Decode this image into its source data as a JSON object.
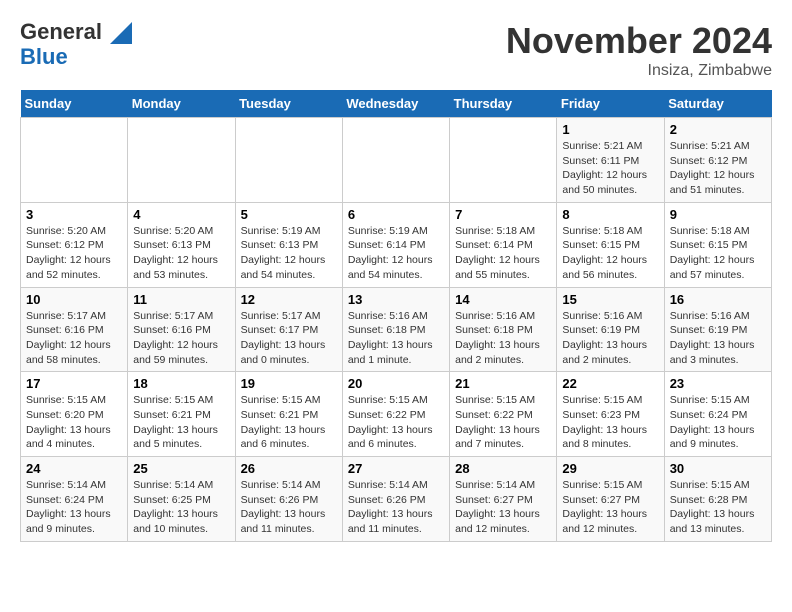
{
  "header": {
    "logo_line1": "General",
    "logo_line2": "Blue",
    "month": "November 2024",
    "location": "Insiza, Zimbabwe"
  },
  "weekdays": [
    "Sunday",
    "Monday",
    "Tuesday",
    "Wednesday",
    "Thursday",
    "Friday",
    "Saturday"
  ],
  "weeks": [
    [
      {
        "day": "",
        "info": ""
      },
      {
        "day": "",
        "info": ""
      },
      {
        "day": "",
        "info": ""
      },
      {
        "day": "",
        "info": ""
      },
      {
        "day": "",
        "info": ""
      },
      {
        "day": "1",
        "info": "Sunrise: 5:21 AM\nSunset: 6:11 PM\nDaylight: 12 hours and 50 minutes."
      },
      {
        "day": "2",
        "info": "Sunrise: 5:21 AM\nSunset: 6:12 PM\nDaylight: 12 hours and 51 minutes."
      }
    ],
    [
      {
        "day": "3",
        "info": "Sunrise: 5:20 AM\nSunset: 6:12 PM\nDaylight: 12 hours and 52 minutes."
      },
      {
        "day": "4",
        "info": "Sunrise: 5:20 AM\nSunset: 6:13 PM\nDaylight: 12 hours and 53 minutes."
      },
      {
        "day": "5",
        "info": "Sunrise: 5:19 AM\nSunset: 6:13 PM\nDaylight: 12 hours and 54 minutes."
      },
      {
        "day": "6",
        "info": "Sunrise: 5:19 AM\nSunset: 6:14 PM\nDaylight: 12 hours and 54 minutes."
      },
      {
        "day": "7",
        "info": "Sunrise: 5:18 AM\nSunset: 6:14 PM\nDaylight: 12 hours and 55 minutes."
      },
      {
        "day": "8",
        "info": "Sunrise: 5:18 AM\nSunset: 6:15 PM\nDaylight: 12 hours and 56 minutes."
      },
      {
        "day": "9",
        "info": "Sunrise: 5:18 AM\nSunset: 6:15 PM\nDaylight: 12 hours and 57 minutes."
      }
    ],
    [
      {
        "day": "10",
        "info": "Sunrise: 5:17 AM\nSunset: 6:16 PM\nDaylight: 12 hours and 58 minutes."
      },
      {
        "day": "11",
        "info": "Sunrise: 5:17 AM\nSunset: 6:16 PM\nDaylight: 12 hours and 59 minutes."
      },
      {
        "day": "12",
        "info": "Sunrise: 5:17 AM\nSunset: 6:17 PM\nDaylight: 13 hours and 0 minutes."
      },
      {
        "day": "13",
        "info": "Sunrise: 5:16 AM\nSunset: 6:18 PM\nDaylight: 13 hours and 1 minute."
      },
      {
        "day": "14",
        "info": "Sunrise: 5:16 AM\nSunset: 6:18 PM\nDaylight: 13 hours and 2 minutes."
      },
      {
        "day": "15",
        "info": "Sunrise: 5:16 AM\nSunset: 6:19 PM\nDaylight: 13 hours and 2 minutes."
      },
      {
        "day": "16",
        "info": "Sunrise: 5:16 AM\nSunset: 6:19 PM\nDaylight: 13 hours and 3 minutes."
      }
    ],
    [
      {
        "day": "17",
        "info": "Sunrise: 5:15 AM\nSunset: 6:20 PM\nDaylight: 13 hours and 4 minutes."
      },
      {
        "day": "18",
        "info": "Sunrise: 5:15 AM\nSunset: 6:21 PM\nDaylight: 13 hours and 5 minutes."
      },
      {
        "day": "19",
        "info": "Sunrise: 5:15 AM\nSunset: 6:21 PM\nDaylight: 13 hours and 6 minutes."
      },
      {
        "day": "20",
        "info": "Sunrise: 5:15 AM\nSunset: 6:22 PM\nDaylight: 13 hours and 6 minutes."
      },
      {
        "day": "21",
        "info": "Sunrise: 5:15 AM\nSunset: 6:22 PM\nDaylight: 13 hours and 7 minutes."
      },
      {
        "day": "22",
        "info": "Sunrise: 5:15 AM\nSunset: 6:23 PM\nDaylight: 13 hours and 8 minutes."
      },
      {
        "day": "23",
        "info": "Sunrise: 5:15 AM\nSunset: 6:24 PM\nDaylight: 13 hours and 9 minutes."
      }
    ],
    [
      {
        "day": "24",
        "info": "Sunrise: 5:14 AM\nSunset: 6:24 PM\nDaylight: 13 hours and 9 minutes."
      },
      {
        "day": "25",
        "info": "Sunrise: 5:14 AM\nSunset: 6:25 PM\nDaylight: 13 hours and 10 minutes."
      },
      {
        "day": "26",
        "info": "Sunrise: 5:14 AM\nSunset: 6:26 PM\nDaylight: 13 hours and 11 minutes."
      },
      {
        "day": "27",
        "info": "Sunrise: 5:14 AM\nSunset: 6:26 PM\nDaylight: 13 hours and 11 minutes."
      },
      {
        "day": "28",
        "info": "Sunrise: 5:14 AM\nSunset: 6:27 PM\nDaylight: 13 hours and 12 minutes."
      },
      {
        "day": "29",
        "info": "Sunrise: 5:15 AM\nSunset: 6:27 PM\nDaylight: 13 hours and 12 minutes."
      },
      {
        "day": "30",
        "info": "Sunrise: 5:15 AM\nSunset: 6:28 PM\nDaylight: 13 hours and 13 minutes."
      }
    ]
  ]
}
